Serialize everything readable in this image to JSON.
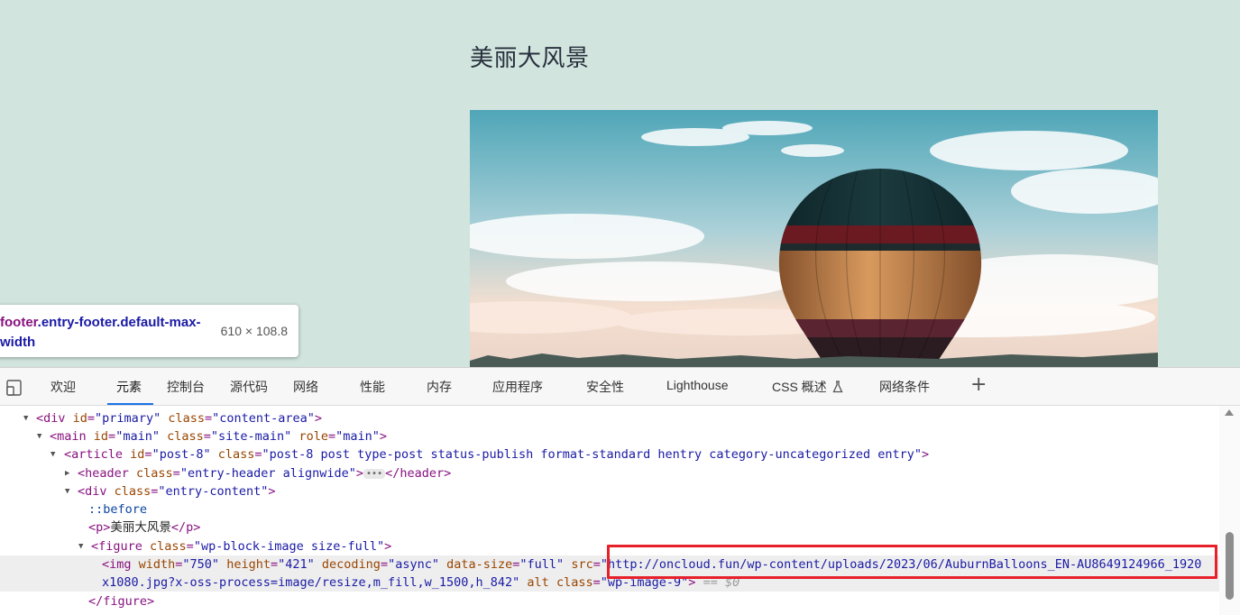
{
  "page": {
    "post_title": "美丽大风景"
  },
  "inspect_tooltip": {
    "selector_tag": "footer",
    "selector_classes": ".entry-footer.default-max-width",
    "size": "610 × 108.8"
  },
  "devtools": {
    "tabs": [
      {
        "label": "欢迎"
      },
      {
        "label": "元素"
      },
      {
        "label": "控制台"
      },
      {
        "label": "源代码"
      },
      {
        "label": "网络"
      },
      {
        "label": "性能"
      },
      {
        "label": "内存"
      },
      {
        "label": "应用程序"
      },
      {
        "label": "安全性"
      },
      {
        "label": "Lighthouse"
      },
      {
        "label": "CSS 概述"
      },
      {
        "label": "网络条件"
      }
    ],
    "active_tab": "元素",
    "plus_label": "+",
    "dom": {
      "l1_attr1_name": "id",
      "l1_attr1_val": "\"primary\"",
      "l1_attr2_name": "class",
      "l1_attr2_val": "\"content-area\"",
      "l2_attr1_name": "id",
      "l2_attr1_val": "\"main\"",
      "l2_attr2_name": "class",
      "l2_attr2_val": "\"site-main\"",
      "l2_attr3_name": "role",
      "l2_attr3_val": "\"main\"",
      "l3_attr1_name": "id",
      "l3_attr1_val": "\"post-8\"",
      "l3_attr2_name": "class",
      "l3_attr2_val": "\"post-8 post type-post status-publish format-standard hentry category-uncategorized entry\"",
      "l4_attr_name": "class",
      "l4_attr_val": "\"entry-header alignwide\"",
      "l5_attr_name": "class",
      "l5_attr_val": "\"entry-content\"",
      "l6_pseudo": "::before",
      "l7_text": "美丽大风景",
      "l8_attr_name": "class",
      "l8_attr_val": "\"wp-block-image size-full\"",
      "l9_width_name": "width",
      "l9_width_val": "\"750\"",
      "l9_height_name": "height",
      "l9_height_val": "\"421\"",
      "l9_decoding_name": "decoding",
      "l9_decoding_val": "\"async\"",
      "l9_datasize_name": "data-size",
      "l9_datasize_val": "\"full\"",
      "l9_src_name": "src",
      "l9_src_part1": "\"http://oncloud.fun/wp-content/uploads/2023/06/AuburnBalloons_EN-AU8649124966_1920",
      "l10_src_part2": "x1080.jpg?x-oss-process=image/resize,m_fill,w_1500,h_842\"",
      "l10_alt_name": "alt",
      "l10_class_name": "class",
      "l10_class_val": "\"wp-image-9\"",
      "l10_console_ref": "== $0"
    }
  }
}
